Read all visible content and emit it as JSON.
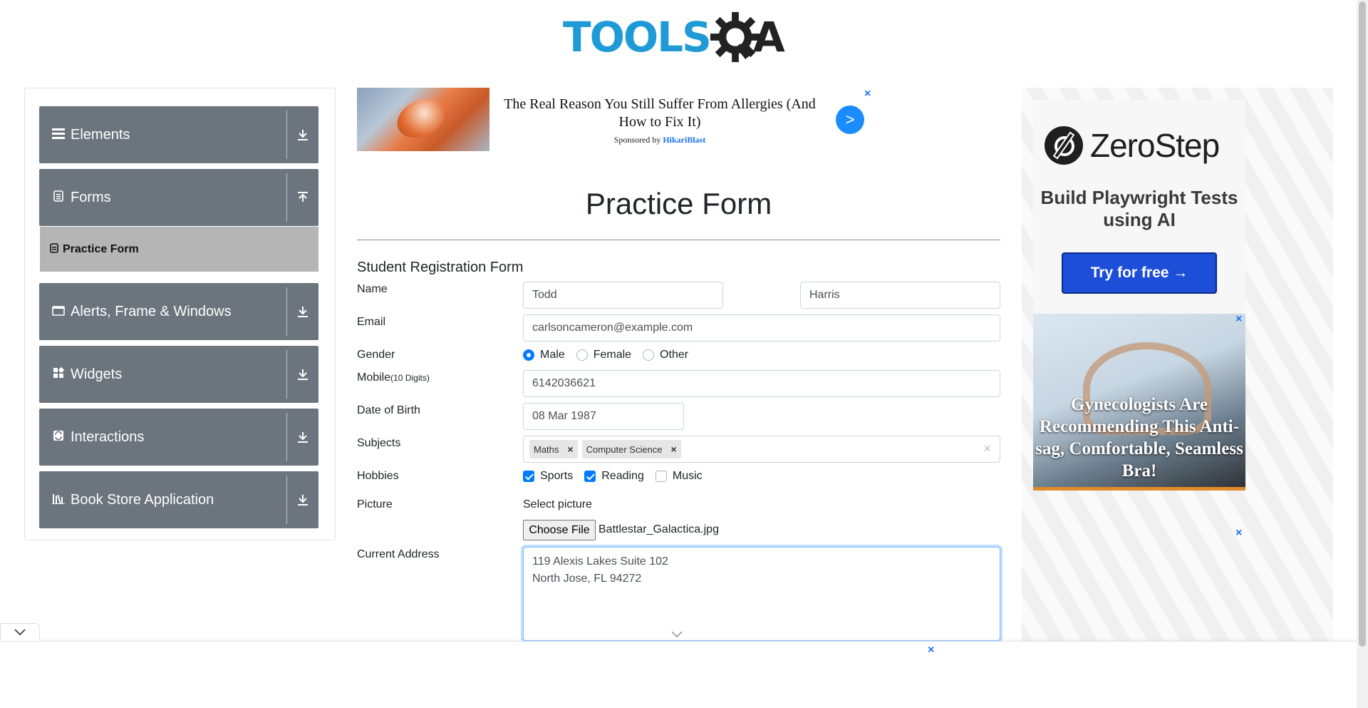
{
  "brand": {
    "logo_text_left": "TOOLS",
    "logo_text_right": "A"
  },
  "sidebar": {
    "groups": [
      {
        "label": "Elements",
        "icon": "hamburger-icon",
        "arrow": "download-arrow-icon"
      },
      {
        "label": "Forms",
        "icon": "document-icon",
        "arrow": "upload-arrow-icon"
      },
      {
        "label": "Alerts, Frame & Windows",
        "icon": "window-icon",
        "arrow": "download-arrow-icon"
      },
      {
        "label": "Widgets",
        "icon": "widgets-icon",
        "arrow": "download-arrow-icon"
      },
      {
        "label": "Interactions",
        "icon": "interactions-icon",
        "arrow": "download-arrow-icon"
      },
      {
        "label": "Book Store Application",
        "icon": "bookstore-icon",
        "arrow": "download-arrow-icon"
      }
    ],
    "active_item": {
      "label": "Practice Form",
      "icon": "form-icon"
    }
  },
  "top_ad": {
    "headline": "The Real Reason You Still Suffer From Allergies (And How to Fix It)",
    "sponsored_by": "Sponsored by",
    "sponsor": "HikariBlast",
    "go": ">",
    "close": "×"
  },
  "form": {
    "title": "Practice Form",
    "heading": "Student Registration Form",
    "name_label": "Name",
    "first_name": "Todd",
    "last_name": "Harris",
    "email_label": "Email",
    "email": "carlsoncameron@example.com",
    "gender_label": "Gender",
    "gender_options": [
      "Male",
      "Female",
      "Other"
    ],
    "gender_selected": "Male",
    "mobile_label": "Mobile",
    "mobile_hint": "(10 Digits)",
    "mobile": "6142036621",
    "dob_label": "Date of Birth",
    "dob": "08 Mar 1987",
    "subjects_label": "Subjects",
    "subjects": [
      "Maths",
      "Computer Science"
    ],
    "subject_remove": "×",
    "subjects_clear": "×",
    "hobbies_label": "Hobbies",
    "hobbies": [
      {
        "label": "Sports",
        "checked": true
      },
      {
        "label": "Reading",
        "checked": true
      },
      {
        "label": "Music",
        "checked": false
      }
    ],
    "picture_label": "Picture",
    "select_picture": "Select picture",
    "choose_file": "Choose File",
    "file_name": "Battlestar_Galactica.jpg",
    "address_label": "Current Address",
    "address": "119 Alexis Lakes Suite 102\nNorth Jose, FL 94272"
  },
  "right_ad": {
    "brand": "ZeroStep",
    "tagline": "Build Playwright Tests using AI",
    "cta": "Try for free →",
    "second_headline": "Gynecologists Are Recommending This Anti-sag, Comfortable, Seamless Bra!",
    "close": "×"
  },
  "bottom_ad": {
    "close": "×"
  },
  "colors": {
    "sidebar": "#6c757d",
    "active_item": "#b5b5b5",
    "accent": "#007bff",
    "logo_blue": "#1e9ad6"
  }
}
